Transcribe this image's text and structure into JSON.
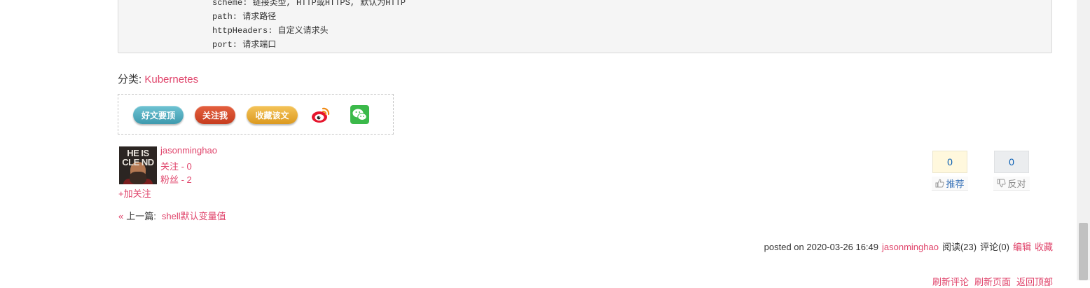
{
  "code_block": {
    "lines": [
      "scheme: 链接类型, HTTP或HTTPS, 默认为HTTP",
      "path: 请求路径",
      "httpHeaders: 自定义请求头",
      "port: 请求端口"
    ]
  },
  "category": {
    "label": "分类:",
    "name": "Kubernetes"
  },
  "share": {
    "digg_button": "好文要顶",
    "follow_button": "关注我",
    "favorite_button": "收藏该文",
    "weibo_icon": "weibo-icon",
    "wechat_icon": "wechat-icon",
    "colors": {
      "digg": "#4fa9bc",
      "follow": "#d44b2a",
      "favorite": "#eab040",
      "weibo_red": "#e6162d",
      "wechat_green": "#3bb94a"
    }
  },
  "author": {
    "avatar_text": "HE IS CLE ND",
    "name": "jasonminghao",
    "follow": "关注 - 0",
    "fans": "粉丝 - 2",
    "add_follow": "+加关注"
  },
  "votes": {
    "digg_count": "0",
    "digg_label": "推荐",
    "bury_count": "0",
    "bury_label": "反对"
  },
  "navigation": {
    "prev_arrow": "«",
    "prev_label": "上一篇:",
    "prev_title": "shell默认变量值"
  },
  "post_info": {
    "posted": "posted on 2020-03-26 16:49",
    "author": "jasonminghao",
    "reads": "阅读(23)",
    "comments": "评论(0)",
    "edit": "编辑",
    "favorite": "收藏"
  },
  "bottom_links": {
    "refresh_comments": "刷新评论",
    "refresh_page": "刷新页面",
    "back_to_top": "返回顶部"
  },
  "accent_color": "#e0446b"
}
